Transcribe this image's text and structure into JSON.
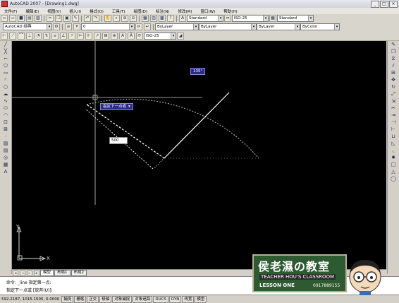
{
  "titlebar": {
    "title": "AutoCAD 2007 - [Drawing1.dwg]"
  },
  "menu": [
    "文件(F)",
    "编辑(E)",
    "视图(V)",
    "插入(I)",
    "格式(O)",
    "工具(T)",
    "绘图(D)",
    "标注(N)",
    "修改(M)",
    "窗口(W)",
    "帮助(H)"
  ],
  "toolbar": {
    "textstyle": "Standard",
    "dimstyle": "ISO-25",
    "tablestyle": "Standard",
    "workspace": "AutoCAD 经典",
    "layer": "0",
    "color": "ByLayer",
    "linetype": "ByLayer",
    "lineweight": "ByLayer",
    "plotstyle": "ByColor",
    "dimstyle2": "ISO-25"
  },
  "canvas": {
    "angle_tooltip": "135°",
    "prompt_tooltip": "指定下一点或",
    "length_input": "500",
    "ucs_y": "Y",
    "ucs_x": "X"
  },
  "tabs": [
    "模型",
    "布局1",
    "布局2"
  ],
  "command": {
    "line1": "命令:  _line  指定第一点:",
    "line2": "指定下一点或 [放弃(U)]:"
  },
  "status": {
    "coords": "592.2187, 1015.1505, 0.0000",
    "toggles": [
      "捕捉",
      "栅格",
      "正交",
      "极轴",
      "对象捕捉",
      "对象追踪",
      "DUCS",
      "DYN",
      "线宽",
      "模型"
    ]
  },
  "watermark": {
    "title": "侯老濕の教室",
    "subtitle": "TEACHER HOU'S CLASSROOM",
    "lesson": "LESSON ONE",
    "phone": "0917889155"
  },
  "colors": {
    "canvas_bg": "#000000",
    "accent": "#2e5a32",
    "tooltip": "#2b2b8a"
  }
}
